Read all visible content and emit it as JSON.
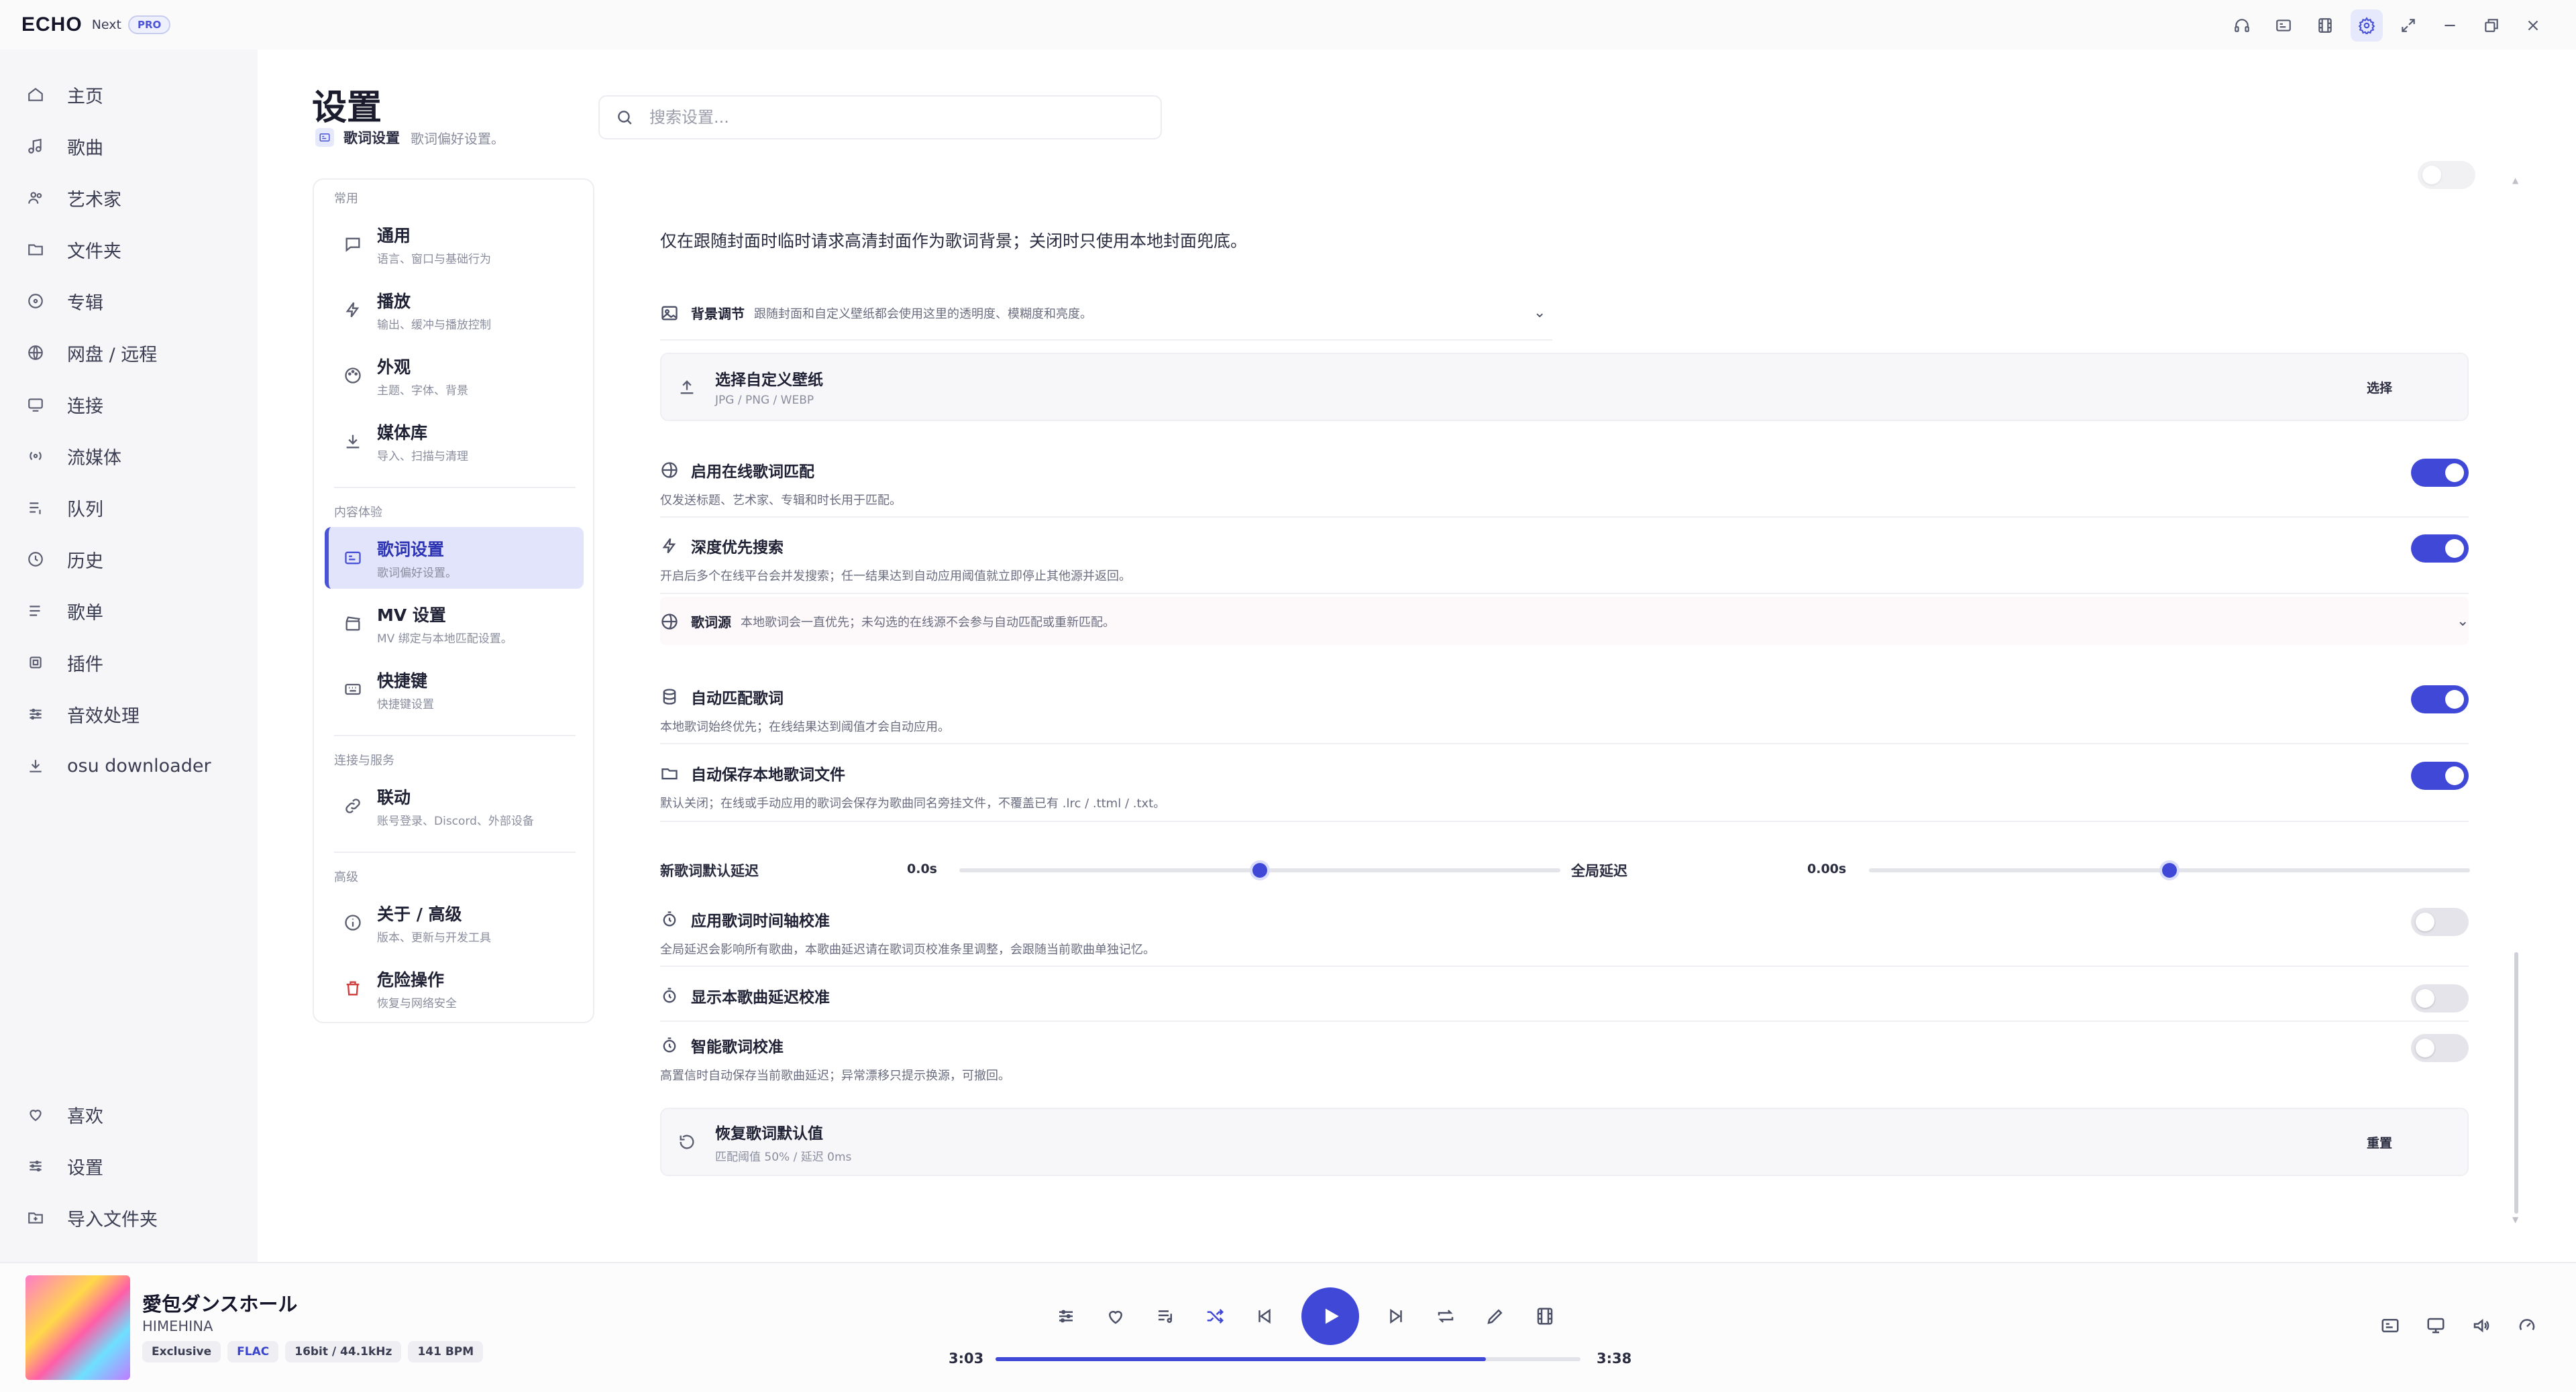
{
  "app": {
    "logo": "ECHO",
    "edition": "Next",
    "badge": "PRO"
  },
  "titlebar_icons": [
    "headphones-icon",
    "lyrics-icon",
    "film-icon",
    "gear-icon",
    "expand-icon",
    "minimize-icon",
    "restore-icon",
    "close-icon"
  ],
  "sidebar": {
    "items": [
      {
        "label": "主页",
        "icon": "home-icon"
      },
      {
        "label": "歌曲",
        "icon": "music-note-icon"
      },
      {
        "label": "艺术家",
        "icon": "users-icon"
      },
      {
        "label": "文件夹",
        "icon": "folder-icon"
      },
      {
        "label": "专辑",
        "icon": "disc-icon"
      },
      {
        "label": "网盘 / 远程",
        "icon": "globe-icon"
      },
      {
        "label": "连接",
        "icon": "cast-icon"
      },
      {
        "label": "流媒体",
        "icon": "radio-icon"
      },
      {
        "label": "队列",
        "icon": "queue-icon"
      },
      {
        "label": "历史",
        "icon": "history-icon"
      },
      {
        "label": "歌单",
        "icon": "playlist-icon"
      },
      {
        "label": "插件",
        "icon": "plugin-icon"
      },
      {
        "label": "音效处理",
        "icon": "equalizer-icon"
      },
      {
        "label": "osu downloader",
        "icon": "download-icon"
      }
    ],
    "bottom": [
      {
        "label": "喜欢",
        "icon": "heart-icon"
      },
      {
        "label": "设置",
        "icon": "sliders-icon"
      },
      {
        "label": "导入文件夹",
        "icon": "folder-plus-icon"
      }
    ]
  },
  "header": {
    "title": "设置",
    "crumb_title": "歌词设置",
    "crumb_sub": "歌词偏好设置。"
  },
  "search": {
    "placeholder": "搜索设置..."
  },
  "categories": {
    "groups": [
      "常用",
      "内容体验",
      "连接与服务",
      "高级"
    ],
    "items": [
      {
        "title": "通用",
        "sub": "语言、窗口与基础行为"
      },
      {
        "title": "播放",
        "sub": "输出、缓冲与播放控制"
      },
      {
        "title": "外观",
        "sub": "主题、字体、背景"
      },
      {
        "title": "媒体库",
        "sub": "导入、扫描与清理"
      },
      {
        "title": "歌词设置",
        "sub": "歌词偏好设置。"
      },
      {
        "title": "MV 设置",
        "sub": "MV 绑定与本地匹配设置。"
      },
      {
        "title": "快捷键",
        "sub": "快捷键设置"
      },
      {
        "title": "联动",
        "sub": "账号登录、Discord、外部设备"
      },
      {
        "title": "关于 / 高级",
        "sub": "版本、更新与开发工具"
      },
      {
        "title": "危险操作",
        "sub": "恢复与网络安全"
      }
    ]
  },
  "lyrics": {
    "cover_note": "仅在跟随封面时临时请求高清封面作为歌词背景；关闭时只使用本地封面兜底。",
    "bg_adjust": {
      "title": "背景调节",
      "desc": "跟随封面和自定义壁纸都会使用这里的透明度、模糊度和亮度。"
    },
    "wallpaper": {
      "title": "选择自定义壁纸",
      "sub": "JPG / PNG / WEBP",
      "button": "选择"
    },
    "online_match": {
      "title": "启用在线歌词匹配",
      "desc": "仅发送标题、艺术家、专辑和时长用于匹配。",
      "enabled": true
    },
    "deep_search": {
      "title": "深度优先搜索",
      "desc": "开启后多个在线平台会并发搜索；任一结果达到自动应用阈值就立即停止其他源并返回。",
      "enabled": true
    },
    "source": {
      "title": "歌词源",
      "desc": "本地歌词会一直优先；未勾选的在线源不会参与自动匹配或重新匹配。"
    },
    "auto_match": {
      "title": "自动匹配歌词",
      "desc": "本地歌词始终优先；在线结果达到阈值才会自动应用。",
      "enabled": true
    },
    "auto_save": {
      "title": "自动保存本地歌词文件",
      "desc": "默认关闭；在线或手动应用的歌词会保存为歌曲同名旁挂文件，不覆盖已有 .lrc / .ttml / .txt。",
      "enabled": true
    },
    "new_delay": {
      "label": "新歌词默认延迟",
      "value": "0.0s",
      "level": 0.5
    },
    "global_delay": {
      "label": "全局延迟",
      "value": "0.00s",
      "level": 0.5
    },
    "timeline_cal": {
      "title": "应用歌词时间轴校准",
      "desc": "全局延迟会影响所有歌曲，本歌曲延迟请在歌词页校准条里调整，会跟随当前歌曲单独记忆。",
      "enabled": false
    },
    "show_delay": {
      "title": "显示本歌曲延迟校准",
      "enabled": false
    },
    "smart_cal": {
      "title": "智能歌词校准",
      "desc": "高置信时自动保存当前歌曲延迟；异常漂移只提示换源，可撤回。",
      "enabled": false
    },
    "restore": {
      "title": "恢复歌词默认值",
      "sub": "匹配阈值 50% / 延迟 0ms",
      "button": "重置"
    }
  },
  "player": {
    "title": "愛包ダンスホール",
    "artist": "HIMEHINA",
    "tags": [
      "Exclusive",
      "FLAC",
      "16bit / 44.1kHz",
      "141 BPM"
    ],
    "elapsed": "3:03",
    "total": "3:38",
    "progress": 0.838,
    "accent": "#4048d8"
  }
}
